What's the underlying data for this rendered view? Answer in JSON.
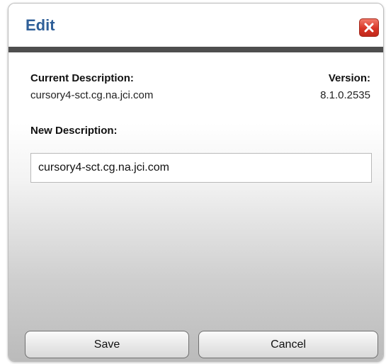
{
  "dialog": {
    "title": "Edit",
    "close_icon": "close-icon"
  },
  "fields": {
    "current_description_label": "Current Description:",
    "current_description_value": "cursory4-sct.cg.na.jci.com",
    "version_label": "Version:",
    "version_value": "8.1.0.2535",
    "new_description_label": "New Description:",
    "new_description_value": "cursory4-sct.cg.na.jci.com"
  },
  "buttons": {
    "save_label": "Save",
    "cancel_label": "Cancel"
  },
  "colors": {
    "title": "#2f5f98",
    "close_button": "#d83526",
    "header_bar": "#4e4e4e"
  }
}
